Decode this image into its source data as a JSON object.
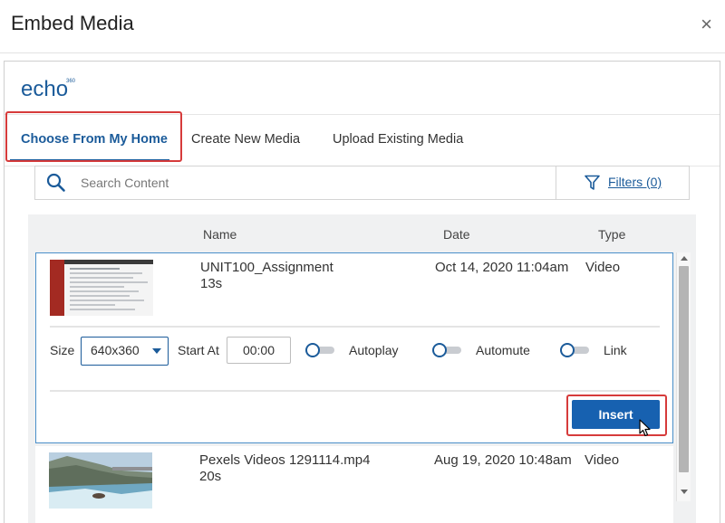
{
  "dialog": {
    "title": "Embed Media",
    "close_icon": "×"
  },
  "brand": {
    "logo_text": "echo",
    "logo_badge": "360"
  },
  "tabs": [
    {
      "label": "Choose From My Home",
      "active": true
    },
    {
      "label": "Create New Media",
      "active": false
    },
    {
      "label": "Upload Existing Media",
      "active": false
    }
  ],
  "search": {
    "placeholder": "Search Content",
    "value": ""
  },
  "filters": {
    "label": "Filters (0)"
  },
  "columns": {
    "name": "Name",
    "date": "Date",
    "type": "Type"
  },
  "media": [
    {
      "name": "UNIT100_Assignment",
      "duration": "13s",
      "date": "Oct 14, 2020 11:04am",
      "type": "Video",
      "expanded": true
    },
    {
      "name": "Pexels Videos 1291114.mp4",
      "duration": "20s",
      "date": "Aug 19, 2020 10:48am",
      "type": "Video",
      "expanded": false
    }
  ],
  "options": {
    "size_label": "Size",
    "size_value": "640x360",
    "start_label": "Start At",
    "start_value": "00:00",
    "toggles": [
      {
        "label": "Autoplay",
        "on": false
      },
      {
        "label": "Automute",
        "on": false
      },
      {
        "label": "Link",
        "on": false
      }
    ],
    "insert_label": "Insert"
  },
  "colors": {
    "accent": "#1b5b9a",
    "button": "#1761b0",
    "highlight": "#d63b3b"
  }
}
